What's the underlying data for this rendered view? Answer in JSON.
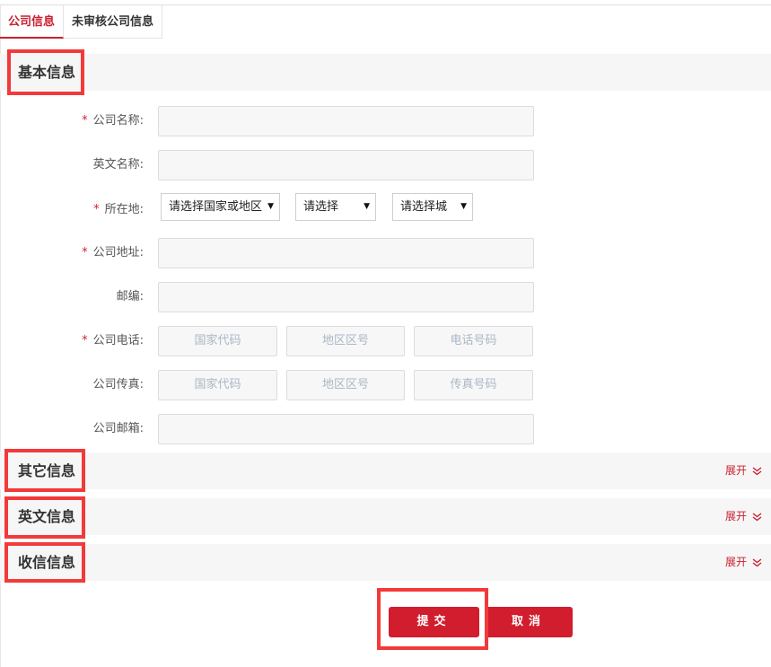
{
  "tabs": [
    {
      "label": "公司信息",
      "active": true
    },
    {
      "label": "未审核公司信息",
      "active": false
    }
  ],
  "sections": {
    "basic": {
      "title": "基本信息"
    },
    "other": {
      "title": "其它信息",
      "expand_label": "展开"
    },
    "english": {
      "title": "英文信息",
      "expand_label": "展开"
    },
    "mailing": {
      "title": "收信信息",
      "expand_label": "展开"
    }
  },
  "form": {
    "company_name": {
      "label": "公司名称:",
      "required_mark": "*",
      "value": ""
    },
    "english_name": {
      "label": "英文名称:",
      "value": ""
    },
    "location": {
      "label": "所在地:",
      "required_mark": "*",
      "country_select": "请选择国家或地区",
      "province_select": "请选择",
      "city_select": "请选择城"
    },
    "address": {
      "label": "公司地址:",
      "required_mark": "*",
      "value": ""
    },
    "postcode": {
      "label": "邮编:",
      "value": ""
    },
    "phone": {
      "label": "公司电话:",
      "required_mark": "*",
      "country_code_placeholder": "国家代码",
      "area_code_placeholder": "地区区号",
      "number_placeholder": "电话号码"
    },
    "fax": {
      "label": "公司传真:",
      "country_code_placeholder": "国家代码",
      "area_code_placeholder": "地区区号",
      "number_placeholder": "传真号码"
    },
    "email": {
      "label": "公司邮箱:",
      "value": ""
    }
  },
  "buttons": {
    "submit": "提交",
    "cancel": "取消"
  },
  "colors": {
    "accent": "#d11d2e",
    "highlight": "#f23a3a",
    "section_bg": "#f6f6f6"
  }
}
